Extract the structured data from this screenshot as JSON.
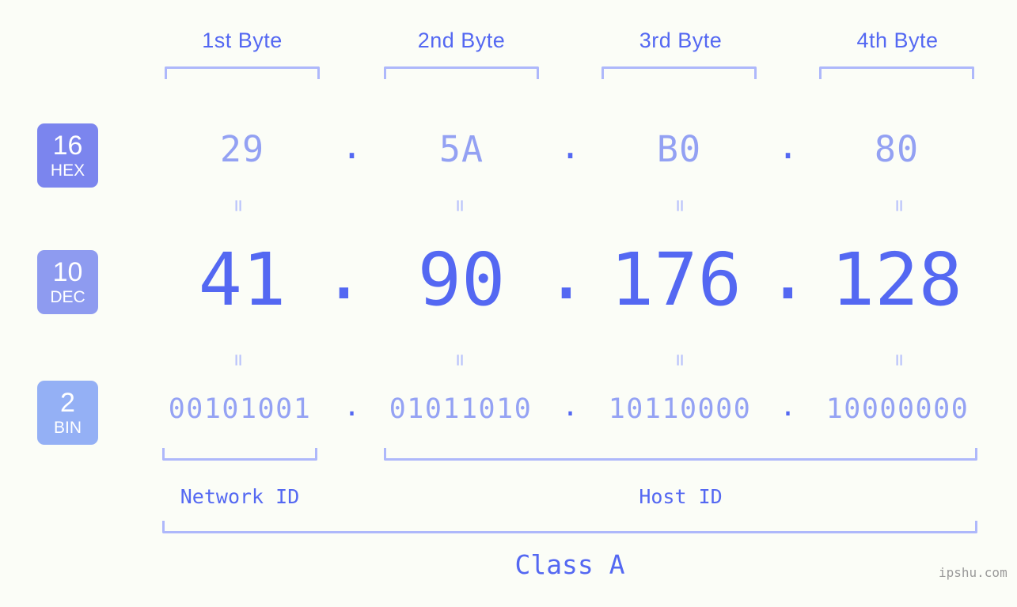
{
  "page": {
    "background_color": "#fbfdf7",
    "accent_color": "#5468f2",
    "light_accent_color": "#aeb8fb",
    "watermark": "ipshu.com"
  },
  "byte_headers": [
    {
      "label": "1st Byte"
    },
    {
      "label": "2nd Byte"
    },
    {
      "label": "3rd Byte"
    },
    {
      "label": "4th Byte"
    }
  ],
  "radix_badges": [
    {
      "number": "16",
      "label": "HEX",
      "color": "#7b85ee"
    },
    {
      "number": "10",
      "label": "DEC",
      "color": "#8e9bf0"
    },
    {
      "number": "2",
      "label": "BIN",
      "color": "#94b0f5"
    }
  ],
  "rows": {
    "hex": {
      "radix": "16",
      "name": "HEX",
      "octets": [
        "29",
        "5A",
        "B0",
        "80"
      ],
      "separator": "."
    },
    "dec": {
      "radix": "10",
      "name": "DEC",
      "octets": [
        "41",
        "90",
        "176",
        "128"
      ],
      "separator": "."
    },
    "bin": {
      "radix": "2",
      "name": "BIN",
      "octets": [
        "00101001",
        "01011010",
        "10110000",
        "10000000"
      ],
      "separator": "."
    }
  },
  "equals_marks": {
    "symbol": "="
  },
  "segments": {
    "network_id": {
      "label": "Network ID"
    },
    "host_id": {
      "label": "Host ID"
    },
    "class": {
      "label": "Class A"
    }
  },
  "ip_address": {
    "dotted_decimal": "41.90.176.128",
    "dotted_hex": "29.5A.B0.80",
    "dotted_binary": "00101001.01011010.10110000.10000000"
  }
}
